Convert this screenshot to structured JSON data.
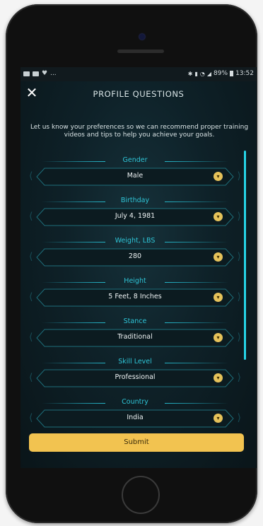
{
  "status": {
    "battery": "89%",
    "time": "13:52",
    "dots": "..."
  },
  "header": {
    "title": "PROFILE QUESTIONS",
    "close_label": "✕"
  },
  "intro": "Let us know your preferences so we can recommend proper training videos and tips to help you achieve your goals.",
  "fields": [
    {
      "label": "Gender",
      "value": "Male"
    },
    {
      "label": "Birthday",
      "value": "July 4, 1981"
    },
    {
      "label": "Weight, LBS",
      "value": "280"
    },
    {
      "label": "Height",
      "value": "5 Feet, 8 Inches"
    },
    {
      "label": "Stance",
      "value": "Traditional"
    },
    {
      "label": "Skill Level",
      "value": "Professional"
    },
    {
      "label": "Country",
      "value": "India"
    }
  ],
  "submit_label": "Submit",
  "colors": {
    "accent": "#26d4e6",
    "submit": "#f2c350",
    "chevron": "#e6c25a",
    "background": "#0d1a1f"
  }
}
